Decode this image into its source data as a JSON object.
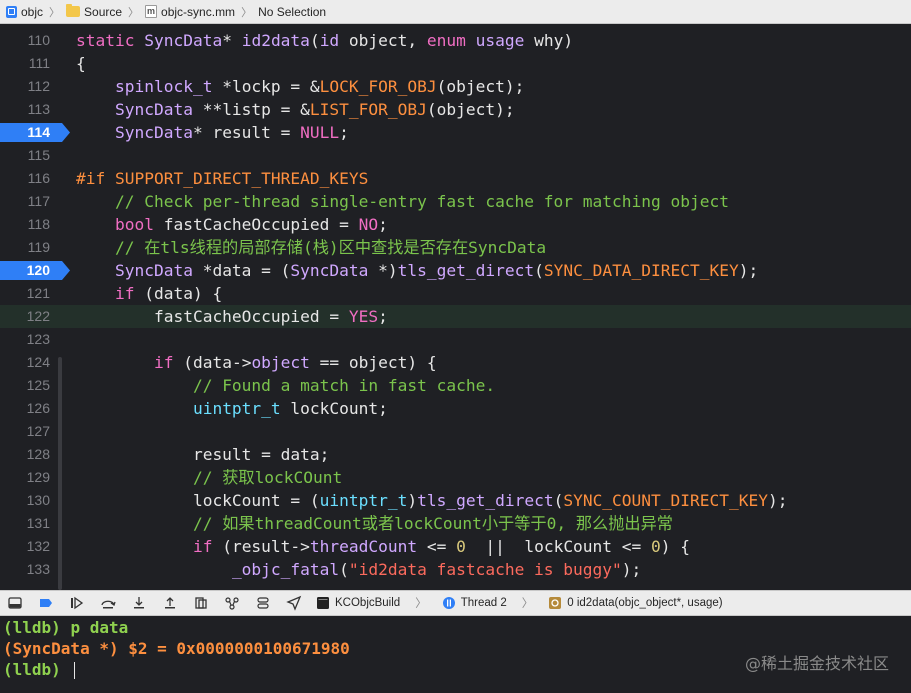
{
  "jumpbar": {
    "project": "objc",
    "folder": "Source",
    "file_glyph": "m",
    "file": "objc-sync.mm",
    "selection": "No Selection"
  },
  "code_lines": [
    {
      "n": "110",
      "bp": false,
      "hl": false,
      "tokens": [
        [
          "kw",
          "static "
        ],
        [
          "ty",
          "SyncData"
        ],
        [
          "pl",
          "* "
        ],
        [
          "fn",
          "id2data"
        ],
        [
          "pl",
          "("
        ],
        [
          "ty",
          "id"
        ],
        [
          "pl",
          " object, "
        ],
        [
          "kw",
          "enum"
        ],
        [
          "pl",
          " "
        ],
        [
          "ty",
          "usage"
        ],
        [
          "pl",
          " why)"
        ]
      ]
    },
    {
      "n": "111",
      "bp": false,
      "hl": false,
      "tokens": [
        [
          "pl",
          "{"
        ]
      ]
    },
    {
      "n": "112",
      "bp": false,
      "hl": false,
      "tokens": [
        [
          "pl",
          "    "
        ],
        [
          "ty",
          "spinlock_t"
        ],
        [
          "pl",
          " *lockp = &"
        ],
        [
          "mac",
          "LOCK_FOR_OBJ"
        ],
        [
          "pl",
          "(object);"
        ]
      ]
    },
    {
      "n": "113",
      "bp": false,
      "hl": false,
      "tokens": [
        [
          "pl",
          "    "
        ],
        [
          "ty",
          "SyncData"
        ],
        [
          "pl",
          " **listp = &"
        ],
        [
          "mac",
          "LIST_FOR_OBJ"
        ],
        [
          "pl",
          "(object);"
        ]
      ]
    },
    {
      "n": "114",
      "bp": true,
      "hl": false,
      "tokens": [
        [
          "pl",
          "    "
        ],
        [
          "ty",
          "SyncData"
        ],
        [
          "pl",
          "* result = "
        ],
        [
          "kw",
          "NULL"
        ],
        [
          "pl",
          ";"
        ]
      ]
    },
    {
      "n": "115",
      "bp": false,
      "hl": false,
      "tokens": []
    },
    {
      "n": "116",
      "bp": false,
      "hl": false,
      "tokens": [
        [
          "pp",
          "#if SUPPORT_DIRECT_THREAD_KEYS"
        ]
      ]
    },
    {
      "n": "117",
      "bp": false,
      "hl": false,
      "tokens": [
        [
          "pl",
          "    "
        ],
        [
          "cm",
          "// Check per-thread single-entry fast cache for matching object"
        ]
      ]
    },
    {
      "n": "118",
      "bp": false,
      "hl": false,
      "tokens": [
        [
          "pl",
          "    "
        ],
        [
          "kw",
          "bool"
        ],
        [
          "pl",
          " fastCacheOccupied = "
        ],
        [
          "kw",
          "NO"
        ],
        [
          "pl",
          ";"
        ]
      ]
    },
    {
      "n": "119",
      "bp": false,
      "hl": false,
      "tokens": [
        [
          "pl",
          "    "
        ],
        [
          "cm",
          "// 在tls线程的局部存储(栈)区中查找是否存在SyncData"
        ]
      ]
    },
    {
      "n": "120",
      "bp": true,
      "hl": false,
      "tokens": [
        [
          "pl",
          "    "
        ],
        [
          "ty",
          "SyncData"
        ],
        [
          "pl",
          " *data = ("
        ],
        [
          "ty",
          "SyncData"
        ],
        [
          "pl",
          " *)"
        ],
        [
          "fn",
          "tls_get_direct"
        ],
        [
          "pl",
          "("
        ],
        [
          "mac",
          "SYNC_DATA_DIRECT_KEY"
        ],
        [
          "pl",
          ");"
        ]
      ]
    },
    {
      "n": "121",
      "bp": false,
      "hl": false,
      "tokens": [
        [
          "pl",
          "    "
        ],
        [
          "kw",
          "if"
        ],
        [
          "pl",
          " (data) {"
        ]
      ]
    },
    {
      "n": "122",
      "bp": false,
      "hl": true,
      "tokens": [
        [
          "pl",
          "        fastCacheOccupied = "
        ],
        [
          "kw",
          "YES"
        ],
        [
          "pl",
          ";"
        ]
      ]
    },
    {
      "n": "123",
      "bp": false,
      "hl": false,
      "tokens": []
    },
    {
      "n": "124",
      "bp": false,
      "hl": false,
      "tokens": [
        [
          "pl",
          "        "
        ],
        [
          "kw",
          "if"
        ],
        [
          "pl",
          " (data->"
        ],
        [
          "fn",
          "object"
        ],
        [
          "pl",
          " == object) {"
        ]
      ]
    },
    {
      "n": "125",
      "bp": false,
      "hl": false,
      "tokens": [
        [
          "pl",
          "            "
        ],
        [
          "cm",
          "// Found a match in fast cache."
        ]
      ]
    },
    {
      "n": "126",
      "bp": false,
      "hl": false,
      "tokens": [
        [
          "pl",
          "            "
        ],
        [
          "tyb",
          "uintptr_t"
        ],
        [
          "pl",
          " lockCount;"
        ]
      ]
    },
    {
      "n": "127",
      "bp": false,
      "hl": false,
      "tokens": []
    },
    {
      "n": "128",
      "bp": false,
      "hl": false,
      "tokens": [
        [
          "pl",
          "            result = data;"
        ]
      ]
    },
    {
      "n": "129",
      "bp": false,
      "hl": false,
      "tokens": [
        [
          "pl",
          "            "
        ],
        [
          "cm",
          "// 获取lockCOunt"
        ]
      ]
    },
    {
      "n": "130",
      "bp": false,
      "hl": false,
      "tokens": [
        [
          "pl",
          "            lockCount = ("
        ],
        [
          "tyb",
          "uintptr_t"
        ],
        [
          "pl",
          ")"
        ],
        [
          "fn",
          "tls_get_direct"
        ],
        [
          "pl",
          "("
        ],
        [
          "mac",
          "SYNC_COUNT_DIRECT_KEY"
        ],
        [
          "pl",
          ");"
        ]
      ]
    },
    {
      "n": "131",
      "bp": false,
      "hl": false,
      "tokens": [
        [
          "pl",
          "            "
        ],
        [
          "cm",
          "// 如果threadCount或者lockCount小于等于0, 那么抛出异常"
        ]
      ]
    },
    {
      "n": "132",
      "bp": false,
      "hl": false,
      "tokens": [
        [
          "pl",
          "            "
        ],
        [
          "kw",
          "if"
        ],
        [
          "pl",
          " (result->"
        ],
        [
          "fn",
          "threadCount"
        ],
        [
          "pl",
          " <= "
        ],
        [
          "nu",
          "0"
        ],
        [
          "pl",
          "  ||  lockCount <= "
        ],
        [
          "nu",
          "0"
        ],
        [
          "pl",
          ") {"
        ]
      ]
    },
    {
      "n": "133",
      "bp": false,
      "hl": false,
      "tokens": [
        [
          "pl",
          "                "
        ],
        [
          "fn",
          "_objc_fatal"
        ],
        [
          "pl",
          "("
        ],
        [
          "st",
          "\"id2data fastcache is buggy\""
        ],
        [
          "pl",
          ");"
        ]
      ]
    }
  ],
  "debugbar": {
    "target": "KCObjcBuild",
    "thread": "Thread 2",
    "frame": "0 id2data(objc_object*, usage)"
  },
  "console": {
    "prompt1": "(lldb) ",
    "cmd1": "p data",
    "output": "(SyncData *) $2 = 0x0000000100671980",
    "prompt2": "(lldb) "
  },
  "watermark": "@稀土掘金技术社区",
  "colors": {
    "editor_bg": "#1f2024",
    "breakpoint": "#2f7ff6",
    "current_line": "#23302a"
  }
}
